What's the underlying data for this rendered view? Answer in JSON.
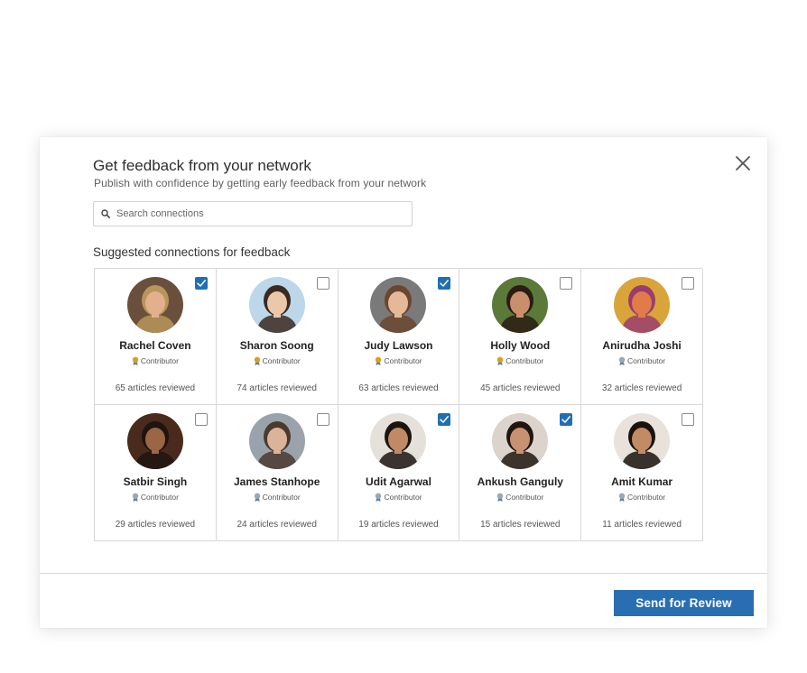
{
  "modal": {
    "title": "Get feedback from your network",
    "subtitle": "Publish with confidence by getting early feedback from your network",
    "search_placeholder": "Search connections",
    "section_title": "Suggested connections for feedback",
    "send_label": "Send for Review",
    "accent_color": "#2a6eb2"
  },
  "connections": [
    {
      "name": "Rachel Coven",
      "badge": "Contributor",
      "badge_tier": "gold",
      "reviews": "65 articles reviewed",
      "checked": true,
      "bg": "#6b4f3d",
      "skin": "#e2b08c",
      "hair": "#b8955a"
    },
    {
      "name": "Sharon Soong",
      "badge": "Contributor",
      "badge_tier": "gold",
      "reviews": "74 articles reviewed",
      "checked": false,
      "bg": "#bcd7ea",
      "skin": "#ecc8ab",
      "hair": "#3a2a22"
    },
    {
      "name": "Judy Lawson",
      "badge": "Contributor",
      "badge_tier": "gold",
      "reviews": "63 articles reviewed",
      "checked": true,
      "bg": "#7a7a7a",
      "skin": "#e5b998",
      "hair": "#6a4630"
    },
    {
      "name": "Holly Wood",
      "badge": "Contributor",
      "badge_tier": "gold",
      "reviews": "45 articles reviewed",
      "checked": false,
      "bg": "#5b7a3a",
      "skin": "#c98f6a",
      "hair": "#2b1c14"
    },
    {
      "name": "Anirudha Joshi",
      "badge": "Contributor",
      "badge_tier": "silver",
      "reviews": "32 articles reviewed",
      "checked": false,
      "bg": "#d9a53a",
      "skin": "#e07b4a",
      "hair": "#9a3d6e"
    },
    {
      "name": "Satbir Singh",
      "badge": "Contributor",
      "badge_tier": "silver",
      "reviews": "29 articles reviewed",
      "checked": false,
      "bg": "#4a2a1c",
      "skin": "#9a6646",
      "hair": "#1e1410"
    },
    {
      "name": "James Stanhope",
      "badge": "Contributor",
      "badge_tier": "silver",
      "reviews": "24 articles reviewed",
      "checked": false,
      "bg": "#9aa3ab",
      "skin": "#d9b49a",
      "hair": "#4a3a2e"
    },
    {
      "name": "Udit Agarwal",
      "badge": "Contributor",
      "badge_tier": "silver",
      "reviews": "19 articles reviewed",
      "checked": true,
      "bg": "#e6e0da",
      "skin": "#c08a66",
      "hair": "#1c1410"
    },
    {
      "name": "Ankush Ganguly",
      "badge": "Contributor",
      "badge_tier": "silver",
      "reviews": "15 articles reviewed",
      "checked": true,
      "bg": "#dcd4cc",
      "skin": "#c89272",
      "hair": "#20160f"
    },
    {
      "name": "Amit Kumar",
      "badge": "Contributor",
      "badge_tier": "silver",
      "reviews": "11 articles reviewed",
      "checked": false,
      "bg": "#e9e2da",
      "skin": "#c28b63",
      "hair": "#1a120c"
    }
  ]
}
